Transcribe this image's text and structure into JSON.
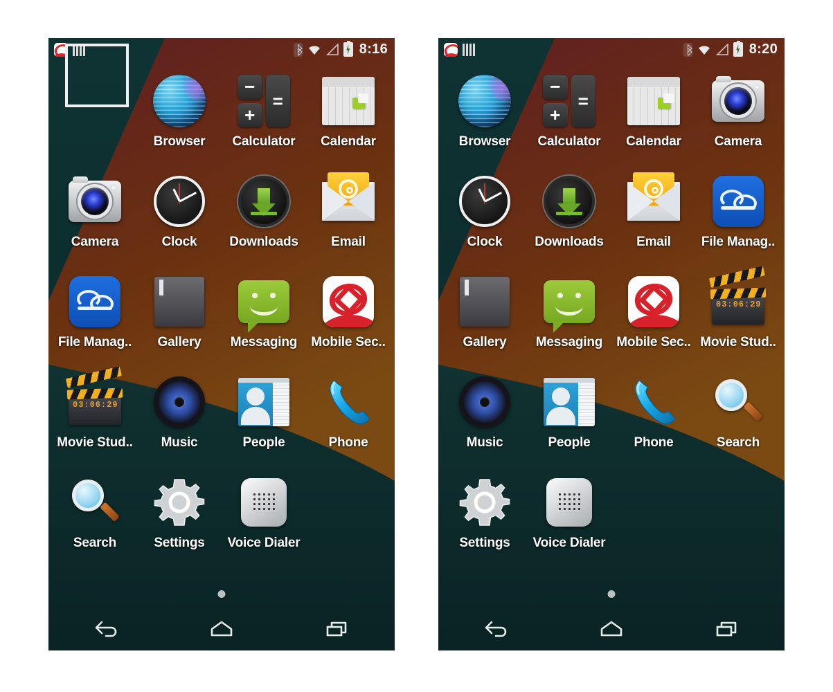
{
  "screens": [
    {
      "id": "left",
      "statusbar": {
        "clock": "8:16",
        "icons_left": [
          "mobile-security-notification-icon",
          "signal-bars-icon"
        ],
        "icons_right": [
          "bluetooth-icon",
          "wifi-icon",
          "cellular-signal-icon",
          "battery-charging-icon"
        ]
      },
      "selection_highlight": true,
      "apps": [
        {
          "label": "",
          "icon": "empty-slot",
          "empty": true
        },
        {
          "label": "Browser",
          "icon": "browser-icon"
        },
        {
          "label": "Calculator",
          "icon": "calculator-icon"
        },
        {
          "label": "Calendar",
          "icon": "calendar-icon"
        },
        {
          "label": "Camera",
          "icon": "camera-icon"
        },
        {
          "label": "Clock",
          "icon": "clock-icon"
        },
        {
          "label": "Downloads",
          "icon": "downloads-icon"
        },
        {
          "label": "Email",
          "icon": "email-icon"
        },
        {
          "label": "File Manag..",
          "icon": "file-manager-icon"
        },
        {
          "label": "Gallery",
          "icon": "gallery-icon"
        },
        {
          "label": "Messaging",
          "icon": "messaging-icon"
        },
        {
          "label": "Mobile Sec..",
          "icon": "mobile-security-icon"
        },
        {
          "label": "Movie Stud..",
          "icon": "movie-studio-icon"
        },
        {
          "label": "Music",
          "icon": "music-icon"
        },
        {
          "label": "People",
          "icon": "people-icon"
        },
        {
          "label": "Phone",
          "icon": "phone-icon"
        },
        {
          "label": "Search",
          "icon": "search-icon"
        },
        {
          "label": "Settings",
          "icon": "settings-icon"
        },
        {
          "label": "Voice Dialer",
          "icon": "voice-dialer-icon"
        }
      ],
      "page_indicator_dots": 1,
      "navbar": [
        "back-icon",
        "home-icon",
        "recents-icon"
      ]
    },
    {
      "id": "right",
      "statusbar": {
        "clock": "8:20",
        "icons_left": [
          "mobile-security-notification-icon",
          "signal-bars-icon"
        ],
        "icons_right": [
          "bluetooth-icon",
          "wifi-icon",
          "cellular-signal-icon",
          "battery-charging-icon"
        ]
      },
      "selection_highlight": false,
      "apps": [
        {
          "label": "Browser",
          "icon": "browser-icon"
        },
        {
          "label": "Calculator",
          "icon": "calculator-icon"
        },
        {
          "label": "Calendar",
          "icon": "calendar-icon"
        },
        {
          "label": "Camera",
          "icon": "camera-icon"
        },
        {
          "label": "Clock",
          "icon": "clock-icon"
        },
        {
          "label": "Downloads",
          "icon": "downloads-icon"
        },
        {
          "label": "Email",
          "icon": "email-icon"
        },
        {
          "label": "File Manag..",
          "icon": "file-manager-icon"
        },
        {
          "label": "Gallery",
          "icon": "gallery-icon"
        },
        {
          "label": "Messaging",
          "icon": "messaging-icon"
        },
        {
          "label": "Mobile Sec..",
          "icon": "mobile-security-icon"
        },
        {
          "label": "Movie Stud..",
          "icon": "movie-studio-icon"
        },
        {
          "label": "Music",
          "icon": "music-icon"
        },
        {
          "label": "People",
          "icon": "people-icon"
        },
        {
          "label": "Phone",
          "icon": "phone-icon"
        },
        {
          "label": "Search",
          "icon": "search-icon"
        },
        {
          "label": "Settings",
          "icon": "settings-icon"
        },
        {
          "label": "Voice Dialer",
          "icon": "voice-dialer-icon"
        }
      ],
      "page_indicator_dots": 1,
      "navbar": [
        "back-icon",
        "home-icon",
        "recents-icon"
      ]
    }
  ],
  "icon_text": {
    "calculator_minus": "−",
    "calculator_plus": "+",
    "calculator_equals": "=",
    "movie_studio_timecode": "03:06:29"
  },
  "colors": {
    "wallpaper_teal": "#0f3333",
    "wallpaper_teal_dark": "#0a2526",
    "wallpaper_maroon": "#5c1d21",
    "wallpaper_brown": "#6b3f10",
    "wallpaper_orange_brown": "#7a4a12",
    "label_text": "#ffffff",
    "selection_border": "#f0f0f0",
    "page_dot": "#b9c4c2",
    "status_text": "#f2f2f2",
    "accent_green": "#9ccb3b",
    "accent_red": "#d8222b",
    "accent_blue": "#1f6fe0"
  }
}
